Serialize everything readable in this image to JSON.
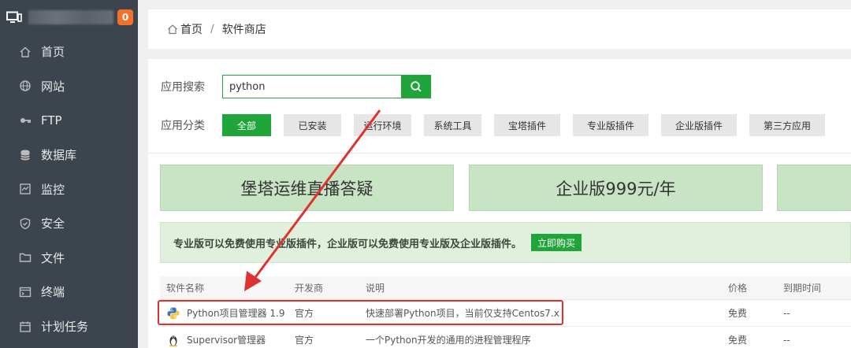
{
  "sidebar": {
    "badge": "0",
    "items": [
      {
        "label": "首页",
        "icon": "home-icon"
      },
      {
        "label": "网站",
        "icon": "globe-icon"
      },
      {
        "label": "FTP",
        "icon": "ftp-icon"
      },
      {
        "label": "数据库",
        "icon": "database-icon"
      },
      {
        "label": "监控",
        "icon": "monitor-icon"
      },
      {
        "label": "安全",
        "icon": "shield-icon"
      },
      {
        "label": "文件",
        "icon": "folder-icon"
      },
      {
        "label": "终端",
        "icon": "terminal-icon"
      },
      {
        "label": "计划任务",
        "icon": "calendar-icon"
      }
    ]
  },
  "breadcrumb": {
    "home": "首页",
    "separator": "/",
    "current": "软件商店"
  },
  "search": {
    "label": "应用搜索",
    "value": "python"
  },
  "categories": {
    "label": "应用分类",
    "items": [
      "全部",
      "已安装",
      "运行环境",
      "系统工具",
      "宝塔插件",
      "专业版插件",
      "企业版插件",
      "第三方应用"
    ],
    "active": "全部"
  },
  "banners": [
    "堡塔运维直播答疑",
    "企业版999元/年",
    ""
  ],
  "notice": {
    "text": "专业版可以免费使用专业版插件，企业版可以免费使用专业版及企业版插件。",
    "button": "立即购买"
  },
  "table": {
    "headers": [
      "软件名称",
      "开发商",
      "说明",
      "价格",
      "到期时间"
    ],
    "rows": [
      {
        "name": "Python项目管理器 1.9",
        "developer": "官方",
        "desc": "快速部署Python项目，当前仅支持Centos7.x",
        "price": "免费",
        "expiry": "--",
        "icon": "python-icon"
      },
      {
        "name": "Supervisor管理器",
        "developer": "官方",
        "desc": "一个Python开发的通用的进程管理程序",
        "price": "免费",
        "expiry": "--",
        "icon": "linux-icon"
      }
    ]
  },
  "colors": {
    "accent": "#20a53a",
    "sidebar": "#3c444d",
    "badge": "#f0722b",
    "annotation": "#e03131",
    "banner": "#c8e4c4"
  }
}
